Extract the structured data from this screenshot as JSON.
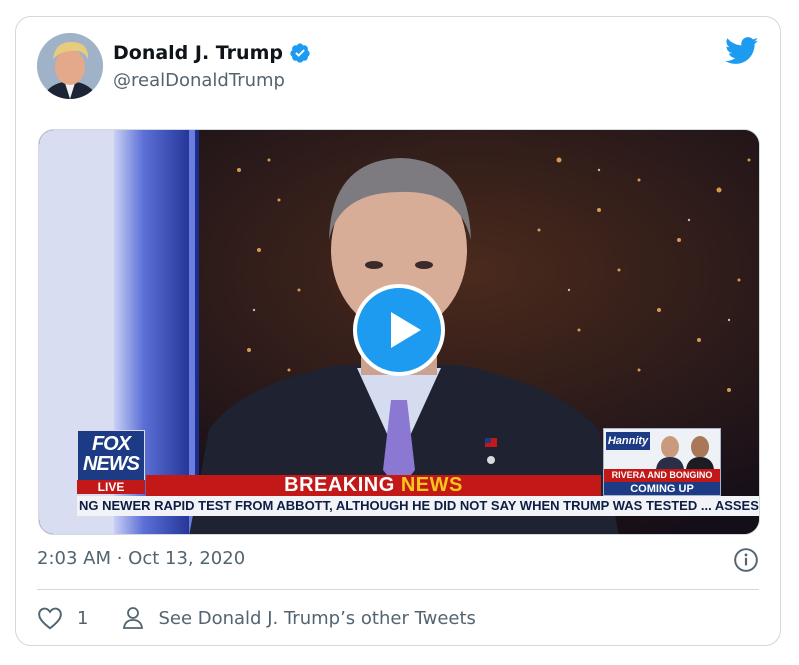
{
  "tweet": {
    "author_name": "Donald J. Trump",
    "handle": "@realDonaldTrump",
    "timestamp": "2:03 AM · Oct 13, 2020",
    "likes": "1",
    "other_tweets_label": "See Donald J. Trump’s other Tweets"
  },
  "video": {
    "network_logo_line1": "FOX",
    "network_logo_line2": "NEWS",
    "live_label": "LIVE",
    "banner_breaking": "BREAKING",
    "banner_news": "NEWS",
    "ticker": "NG NEWER RAPID TEST FROM ABBOTT, ALTHOUGH HE DID NOT SAY WHEN TRUMP WAS TESTED ...   ASSES",
    "promo_show": "Hannity",
    "promo_guests": "RIVERA AND BONGINO",
    "promo_status": "COMING UP"
  },
  "icons": {
    "verified": "verified-badge-icon",
    "platform": "twitter-bird-icon",
    "play": "play-icon",
    "info": "info-icon",
    "like": "heart-icon",
    "profile": "person-icon"
  },
  "colors": {
    "accent": "#1d9bf0",
    "text_secondary": "#536471",
    "border": "#cfd9de",
    "fox_red": "#c21818",
    "fox_blue": "#1d3b84",
    "news_yellow": "#f7c81a"
  }
}
